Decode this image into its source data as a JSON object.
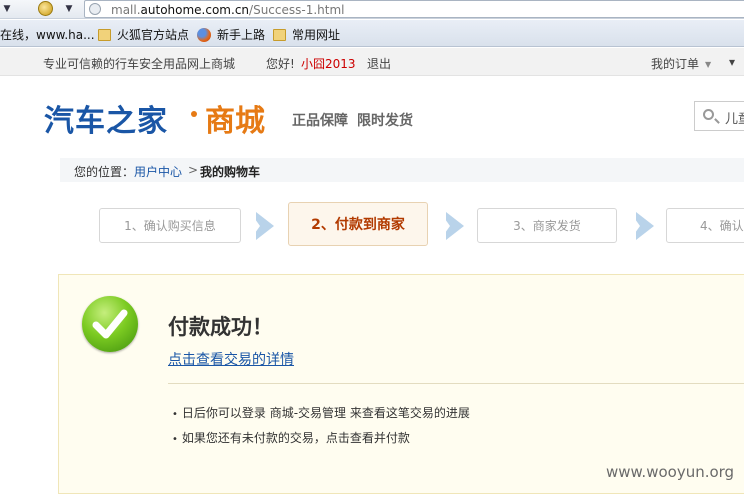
{
  "browser": {
    "url_prefix": "mall.",
    "url_domain": "autohome.com.cn",
    "url_path": "/Success-1.html",
    "bookmarks": [
      "在线，www.ha...",
      "火狐官方站点",
      "新手上路",
      "常用网址"
    ]
  },
  "topbar": {
    "tagline": "专业可信赖的行车安全用品网上商城",
    "greeting": "您好!",
    "username": "小囧2013",
    "logout": "退出",
    "my_orders": "我的订单",
    "more": "▾"
  },
  "header": {
    "logo_main": "汽车之家",
    "logo_sub": "商城",
    "slogan_1": "正品保障",
    "slogan_2": "限时发货",
    "search_text": "儿童"
  },
  "breadcrumb": {
    "label": "您的位置：",
    "link": "用户中心",
    "sep": ">",
    "current": "我的购物车"
  },
  "steps": [
    "1、确认购买信息",
    "2、付款到商家",
    "3、商家发货",
    "4、确认"
  ],
  "success": {
    "title": "付款成功！",
    "detail_link": "点击查看交易的详情",
    "notes": [
      "日后你可以登录 商城-交易管理 来查看这笔交易的进展",
      "如果您还有未付款的交易，点击查看并付款"
    ]
  },
  "watermark": "www.wooyun.org"
}
